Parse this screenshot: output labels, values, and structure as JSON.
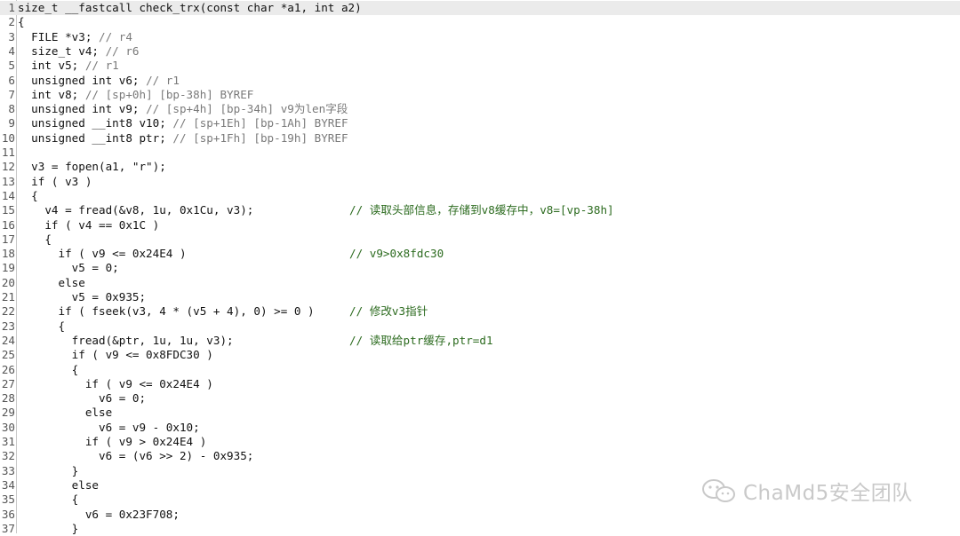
{
  "editor": {
    "lines": [
      {
        "n": "1",
        "text": "size_t __fastcall check_trx(const char *a1, int a2)",
        "comment": ""
      },
      {
        "n": "2",
        "text": "{",
        "comment": ""
      },
      {
        "n": "3",
        "text": "  FILE *v3; // r4",
        "comment": ""
      },
      {
        "n": "4",
        "text": "  size_t v4; // r6",
        "comment": ""
      },
      {
        "n": "5",
        "text": "  int v5; // r1",
        "comment": ""
      },
      {
        "n": "6",
        "text": "  unsigned int v6; // r1",
        "comment": ""
      },
      {
        "n": "7",
        "text": "  int v8; // [sp+0h] [bp-38h] BYREF",
        "comment": ""
      },
      {
        "n": "8",
        "text": "  unsigned int v9; // [sp+4h] [bp-34h] v9为len字段",
        "comment": ""
      },
      {
        "n": "9",
        "text": "  unsigned __int8 v10; // [sp+1Eh] [bp-1Ah] BYREF",
        "comment": ""
      },
      {
        "n": "10",
        "text": "  unsigned __int8 ptr; // [sp+1Fh] [bp-19h] BYREF",
        "comment": ""
      },
      {
        "n": "11",
        "text": "",
        "comment": ""
      },
      {
        "n": "12",
        "text": "  v3 = fopen(a1, \"r\");",
        "comment": ""
      },
      {
        "n": "13",
        "text": "  if ( v3 )",
        "comment": ""
      },
      {
        "n": "14",
        "text": "  {",
        "comment": ""
      },
      {
        "n": "15",
        "text": "    v4 = fread(&v8, 1u, 0x1Cu, v3);",
        "comment": "// 读取头部信息，存储到v8缓存中，v8=[vp-38h]"
      },
      {
        "n": "16",
        "text": "    if ( v4 == 0x1C )",
        "comment": ""
      },
      {
        "n": "17",
        "text": "    {",
        "comment": ""
      },
      {
        "n": "18",
        "text": "      if ( v9 <= 0x24E4 )",
        "comment": "// v9>0x8fdc30"
      },
      {
        "n": "19",
        "text": "        v5 = 0;",
        "comment": ""
      },
      {
        "n": "20",
        "text": "      else",
        "comment": ""
      },
      {
        "n": "21",
        "text": "        v5 = 0x935;",
        "comment": ""
      },
      {
        "n": "22",
        "text": "      if ( fseek(v3, 4 * (v5 + 4), 0) >= 0 )",
        "comment": "// 修改v3指针"
      },
      {
        "n": "23",
        "text": "      {",
        "comment": ""
      },
      {
        "n": "24",
        "text": "        fread(&ptr, 1u, 1u, v3);",
        "comment": "// 读取给ptr缓存,ptr=d1"
      },
      {
        "n": "25",
        "text": "        if ( v9 <= 0x8FDC30 )",
        "comment": ""
      },
      {
        "n": "26",
        "text": "        {",
        "comment": ""
      },
      {
        "n": "27",
        "text": "          if ( v9 <= 0x24E4 )",
        "comment": ""
      },
      {
        "n": "28",
        "text": "            v6 = 0;",
        "comment": ""
      },
      {
        "n": "29",
        "text": "          else",
        "comment": ""
      },
      {
        "n": "30",
        "text": "            v6 = v9 - 0x10;",
        "comment": ""
      },
      {
        "n": "31",
        "text": "          if ( v9 > 0x24E4 )",
        "comment": ""
      },
      {
        "n": "32",
        "text": "            v6 = (v6 >> 2) - 0x935;",
        "comment": ""
      },
      {
        "n": "33",
        "text": "        }",
        "comment": ""
      },
      {
        "n": "34",
        "text": "        else",
        "comment": ""
      },
      {
        "n": "35",
        "text": "        {",
        "comment": ""
      },
      {
        "n": "36",
        "text": "          v6 = 0x23F708;",
        "comment": ""
      },
      {
        "n": "37",
        "text": "        }",
        "comment": ""
      }
    ]
  },
  "watermark": {
    "text": "ChaMd5安全团队"
  },
  "colors": {
    "highlight": "#ebebeb",
    "comment": "#2c6b1f",
    "variable": "#7a7a7a",
    "text": "#111111"
  }
}
